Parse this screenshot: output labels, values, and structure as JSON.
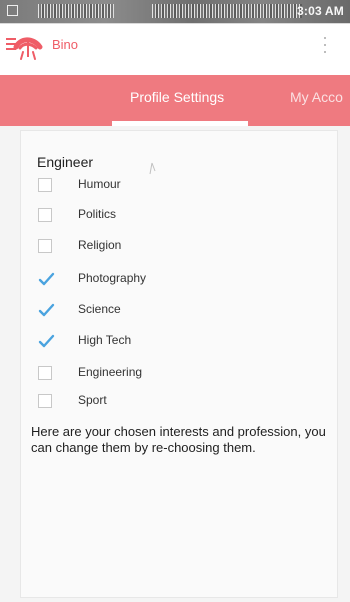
{
  "status_bar": {
    "time": "3:03 AM"
  },
  "app_bar": {
    "brand": "Bino",
    "icons": [
      "menu-icon",
      "bino-logo-icon",
      "more-vertical-icon"
    ]
  },
  "tabs": [
    {
      "label": "Profile Settings",
      "selected": true
    },
    {
      "label": "My Acco",
      "selected": false
    }
  ],
  "profile": {
    "profession": "Engineer",
    "interests": [
      {
        "label": "Humour",
        "checked": false
      },
      {
        "label": "Politics",
        "checked": false
      },
      {
        "label": "Religion",
        "checked": false
      },
      {
        "label": "Photography",
        "checked": true
      },
      {
        "label": "Science",
        "checked": true
      },
      {
        "label": "High Tech",
        "checked": true
      },
      {
        "label": "Engineering",
        "checked": false
      },
      {
        "label": "Sport",
        "checked": false
      }
    ],
    "note": "Here are your chosen interests and profession, you can change them by re-choosing them."
  },
  "colors": {
    "accent": "#ef5d67",
    "tab_bar": "#ef7a80",
    "checkmark": "#4aa3df"
  }
}
